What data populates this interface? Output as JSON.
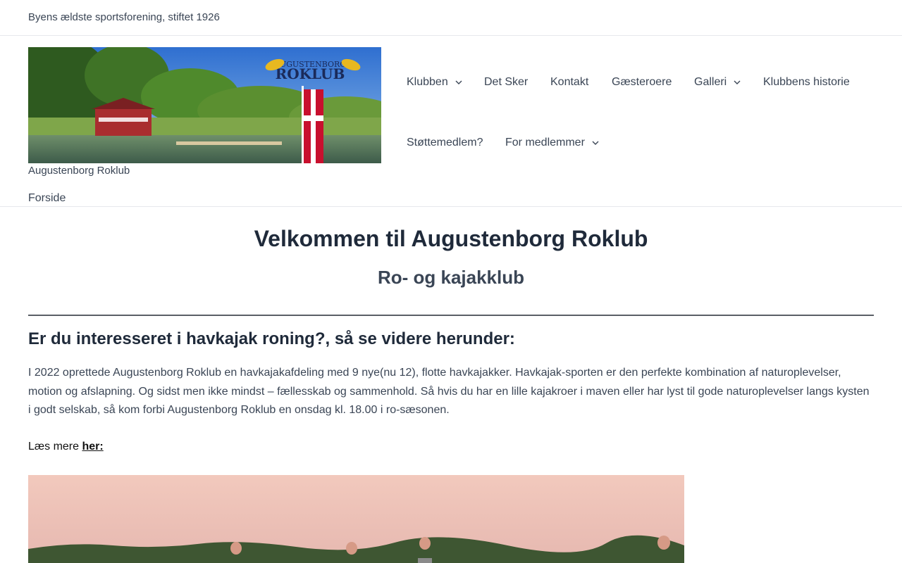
{
  "topbar": {
    "tagline": "Byens ældste sportsforening, stiftet 1926"
  },
  "header": {
    "logo_text": "AUGUSTENBORG",
    "logo_brand": "ROKLUB",
    "site_title": "Augustenborg Roklub",
    "breadcrumb": "Forside"
  },
  "nav": {
    "items": [
      {
        "label": "Klubben",
        "has_dropdown": true
      },
      {
        "label": "Det Sker",
        "has_dropdown": false
      },
      {
        "label": "Kontakt",
        "has_dropdown": false
      },
      {
        "label": "Gæsteroere",
        "has_dropdown": false
      },
      {
        "label": "Galleri",
        "has_dropdown": true
      },
      {
        "label": "Klubbens historie",
        "has_dropdown": false
      },
      {
        "label": "Støttemedlem?",
        "has_dropdown": false
      },
      {
        "label": "For medlemmer",
        "has_dropdown": true
      }
    ]
  },
  "main": {
    "title": "Velkommen til Augustenborg Roklub",
    "subtitle": "Ro- og kajakklub",
    "section_heading": "Er du interesseret i havkajak roning?, så se videre herunder:",
    "intro": "I 2022 oprettede Augustenborg Roklub en havkajakafdeling med 9 nye(nu 12), flotte havkajakker. Havkajak-sporten er den perfekte kombination af naturoplevelser, motion og afslapning. Og sidst men ikke mindst – fællesskab og sammenhold. Så hvis du har en lille kajakroer i maven eller har lyst til gode naturoplevelser langs kysten i godt selskab, så kom forbi Augustenborg Roklub en onsdag kl. 18.00 i ro-sæsonen.",
    "read_more_prefix": "Læs mere ",
    "read_more_link": "her:"
  },
  "colors": {
    "text": "#3a4555",
    "heading": "#1f2a3a",
    "border": "#e6e8ec",
    "flag_red": "#c8102e",
    "logo_gold": "#e8b820"
  }
}
